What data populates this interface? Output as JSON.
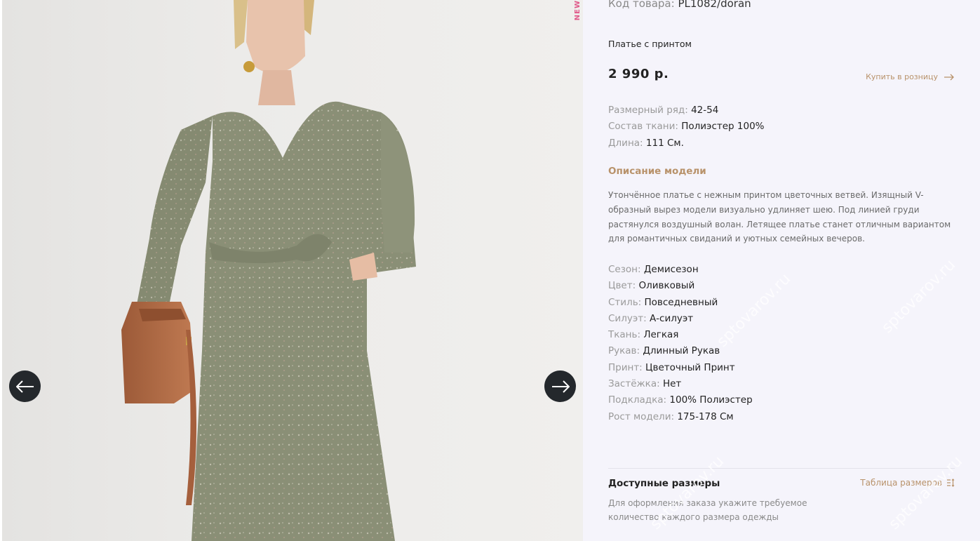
{
  "gallery": {
    "new_label": "NEW",
    "prev_icon": "arrow-left-icon",
    "next_icon": "arrow-right-icon"
  },
  "product": {
    "sku_label": "Код товара:",
    "sku_value": "PL1082/doran",
    "title": "Платье с принтом",
    "price": "2 990 р.",
    "retail_link": "Купить в розницу",
    "specs": [
      {
        "label": "Размерный ряд:",
        "value": "42-54"
      },
      {
        "label": "Состав ткани:",
        "value": "Полиэстер 100%"
      },
      {
        "label": "Длина:",
        "value": "111 См."
      }
    ],
    "description_heading": "Описание модели",
    "description": "Утончённое платье с нежным принтом цветочных ветвей. Изящный V-образный вырез модели визуально удлиняет шею. Под линией груди растянулся воздушный волан. Летящее платье станет отличным вариантом для романтичных свиданий и уютных семейных вечеров.",
    "attributes": [
      {
        "label": "Сезон:",
        "value": "Демисезон"
      },
      {
        "label": "Цвет:",
        "value": "Оливковый"
      },
      {
        "label": "Стиль:",
        "value": "Повседневный"
      },
      {
        "label": "Силуэт:",
        "value": "А-силуэт"
      },
      {
        "label": "Ткань:",
        "value": "Легкая"
      },
      {
        "label": "Рукав:",
        "value": "Длинный Рукав"
      },
      {
        "label": "Принт:",
        "value": "Цветочный Принт"
      },
      {
        "label": "Застёжка:",
        "value": "Нет"
      },
      {
        "label": "Подкладка:",
        "value": "100% Полиэстер"
      },
      {
        "label": "Рост модели:",
        "value": "175-178 См"
      }
    ]
  },
  "sizes": {
    "heading": "Доступные размеры",
    "table_link": "Таблица размеров",
    "note": "Для оформления заказа укажите требуемое количество каждого размера одежды"
  },
  "watermark": "sptovarov.ru",
  "colors": {
    "accent": "#b8926a",
    "panel_bg": "#f5f4fb",
    "dress": "#8a8f76",
    "bag": "#b06a45",
    "arrow_btn": "#24282c"
  }
}
